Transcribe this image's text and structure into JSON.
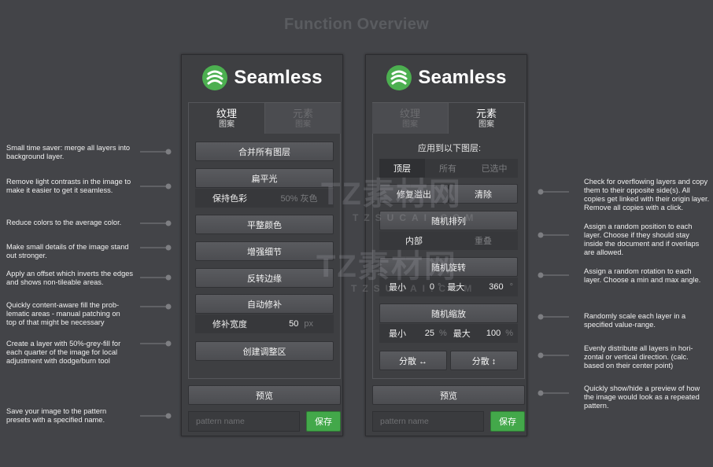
{
  "header": {
    "title": "Function Overview"
  },
  "brand": {
    "name": "Seamless",
    "color": "#4caf50"
  },
  "left_panel": {
    "tabs": [
      {
        "label": "纹理",
        "sub": "图案"
      },
      {
        "label": "元素",
        "sub": "图案"
      }
    ],
    "merge": "合并所有图层",
    "flatten": "扁平光",
    "keep_color": "保持色彩",
    "grey_pct": "50% 灰色",
    "even_color": "平整颜色",
    "enhance": "增强细节",
    "invert_edges": "反转边缘",
    "auto_patch": "自动修补",
    "patch_width_label": "修补宽度",
    "patch_width_value": "50",
    "patch_width_unit": "px",
    "create_adjust": "创建调整区",
    "preview": "预览",
    "pattern_placeholder": "pattern name",
    "save": "保存"
  },
  "right_panel": {
    "tabs": [
      {
        "label": "纹理",
        "sub": "图案"
      },
      {
        "label": "元素",
        "sub": "图案"
      }
    ],
    "apply_to": "应用到以下图层:",
    "layer_options": [
      "顶层",
      "所有",
      "已选中"
    ],
    "fix_overflow": "修复溢出",
    "clear": "清除",
    "random_arrange": "随机排列",
    "inside": "内部",
    "overlap": "重叠",
    "random_rotate": "随机旋转",
    "rot_min_label": "最小",
    "rot_min_value": "0",
    "rot_max_label": "最大",
    "rot_max_value": "360",
    "rot_unit": "°",
    "random_scale": "随机缩放",
    "scale_min_label": "最小",
    "scale_min_value": "25",
    "scale_max_label": "最大",
    "scale_max_value": "100",
    "scale_unit": "%",
    "distribute_h": "分散 ↔",
    "distribute_v": "分散 ↕",
    "preview": "预览",
    "pattern_placeholder": "pattern name",
    "save": "保存"
  },
  "notes_left": [
    "Small time saver: merge all layers into background layer.",
    "Remove light contrasts in the image to make it easier to get it seamless.",
    "Reduce colors to the average color.",
    "Make small details of the image stand out stronger.",
    "Apply an offset which inverts the edges and shows non-tileable areas.",
    "Quickly content-aware fill the prob-lematic areas - manual patching on top of that might be necessary",
    "Create a layer with 50%-grey-fill for each quarter of the image for local adjustment with dodge/burn tool",
    "Save your image to the pattern presets with a specified name."
  ],
  "notes_right": [
    "Check for overflowing layers and copy them to their opposite side(s). All copies get linked with their origin layer. Remove all copies with a click.",
    "Assign a random position to each layer. Choose if they should stay inside the document and if overlaps are allowed.",
    "Assign a random rotation to each layer. Choose a min and max angle.",
    "Randomly scale each layer in a specified value-range.",
    "Evenly distribute all layers in hori-zontal or vertical direction. (calc. based on their center point)",
    "Quickly show/hide a preview of how the image would look as a repeated pattern."
  ],
  "watermark": {
    "text": "TZ素材网",
    "sub": "TZSUCAI.COM"
  }
}
